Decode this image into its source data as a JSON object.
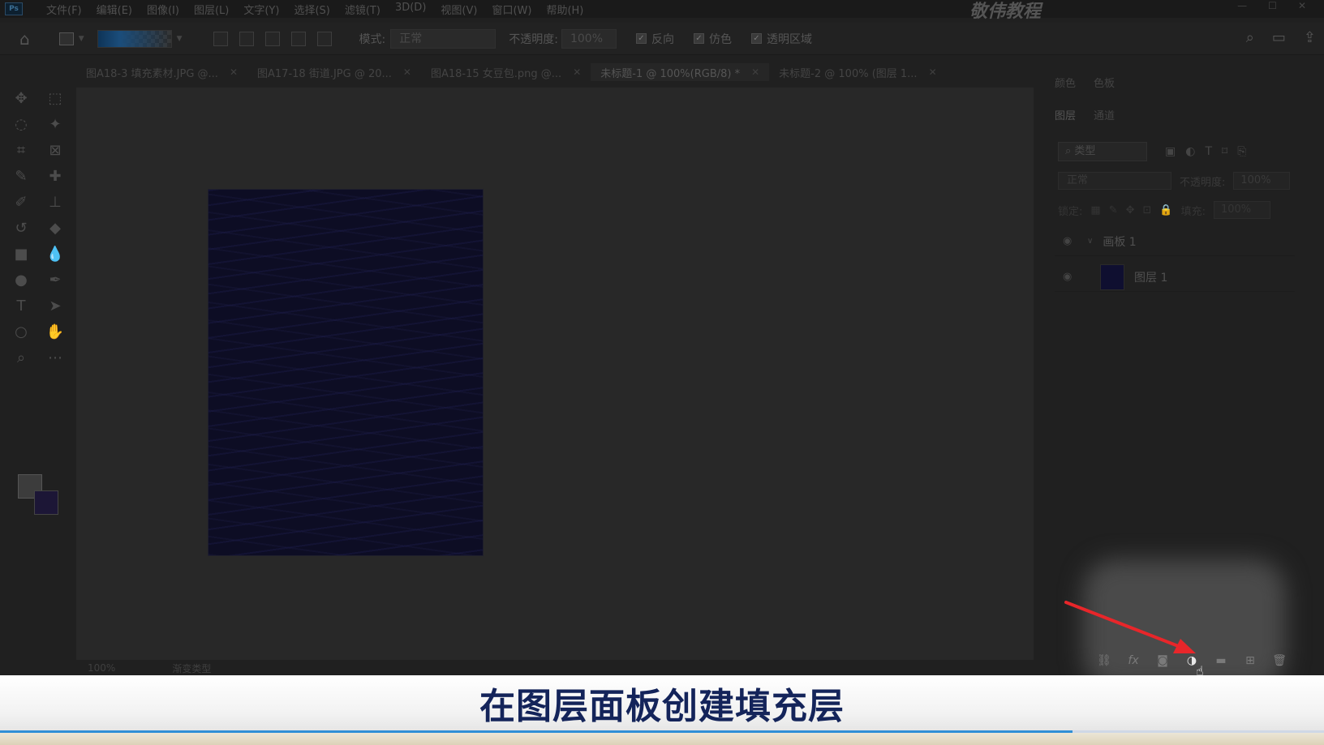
{
  "app": {
    "logo": "Ps",
    "watermark": "敬伟教程"
  },
  "menu": [
    "文件(F)",
    "编辑(E)",
    "图像(I)",
    "图层(L)",
    "文字(Y)",
    "选择(S)",
    "滤镜(T)",
    "3D(D)",
    "视图(V)",
    "窗口(W)",
    "帮助(H)"
  ],
  "options": {
    "mode_label": "模式:",
    "mode_value": "正常",
    "opacity_label": "不透明度:",
    "opacity_value": "100%",
    "reverse": "反向",
    "dither": "仿色",
    "transparency": "透明区域"
  },
  "tabs": [
    {
      "label": "图A18-3 填充素材.JPG @..."
    },
    {
      "label": "图A17-18 街道.JPG @ 20..."
    },
    {
      "label": "图A18-15 女豆包.png @..."
    },
    {
      "label": "未标题-1 @ 100%(RGB/8) *"
    },
    {
      "label": "未标题-2 @ 100% (图层 1..."
    }
  ],
  "status": {
    "zoom": "100%",
    "info": "渐变类型"
  },
  "panels": {
    "top_tabs": [
      "颜色",
      "色板"
    ],
    "layer_tabs": [
      "图层",
      "通道"
    ],
    "filter_label": "类型",
    "blend_mode": "正常",
    "opacity_label": "不透明度:",
    "opacity_value": "100%",
    "lock_label": "锁定:",
    "fill_label": "填充:",
    "fill_value": "100%"
  },
  "layers": [
    {
      "name": "画板 1"
    },
    {
      "name": "图层 1"
    }
  ],
  "subtitle": "在图层面板创建填充层",
  "progress": 0.81,
  "colors": {
    "accent": "#2f8fd6",
    "arrow": "#e8262a",
    "subtitle": "#14245a"
  }
}
